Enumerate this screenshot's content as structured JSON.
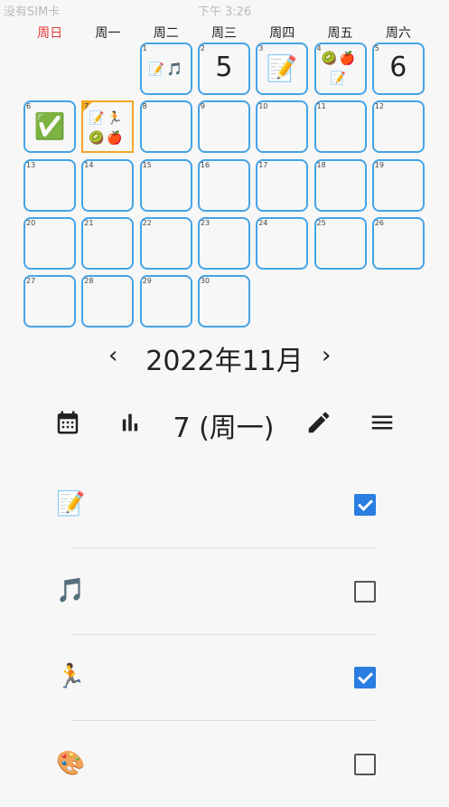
{
  "status": {
    "carrier": "没有SIM卡",
    "time": "下午 3:26"
  },
  "weekdays": [
    "周日",
    "周一",
    "周二",
    "周三",
    "周四",
    "周五",
    "周六"
  ],
  "calendar": {
    "days": [
      {
        "n": "1",
        "col": 2,
        "row": 0,
        "icons": [
          "📝",
          "🎵"
        ]
      },
      {
        "n": "2",
        "col": 3,
        "row": 0,
        "big": "5"
      },
      {
        "n": "3",
        "col": 4,
        "row": 0,
        "bigicon": "📝"
      },
      {
        "n": "4",
        "col": 5,
        "row": 0,
        "icons": [
          "🥝",
          "🍎",
          "📝"
        ]
      },
      {
        "n": "5",
        "col": 6,
        "row": 0,
        "big": "6"
      },
      {
        "n": "6",
        "col": 0,
        "row": 1,
        "bigicon": "✅"
      },
      {
        "n": "7",
        "col": 1,
        "row": 1,
        "selected": true,
        "icons": [
          "📝",
          "🏃",
          "🥝",
          "🍎"
        ]
      },
      {
        "n": "8",
        "col": 2,
        "row": 1
      },
      {
        "n": "9",
        "col": 3,
        "row": 1
      },
      {
        "n": "10",
        "col": 4,
        "row": 1
      },
      {
        "n": "11",
        "col": 5,
        "row": 1
      },
      {
        "n": "12",
        "col": 6,
        "row": 1
      },
      {
        "n": "13",
        "col": 0,
        "row": 2
      },
      {
        "n": "14",
        "col": 1,
        "row": 2
      },
      {
        "n": "15",
        "col": 2,
        "row": 2
      },
      {
        "n": "16",
        "col": 3,
        "row": 2
      },
      {
        "n": "17",
        "col": 4,
        "row": 2
      },
      {
        "n": "18",
        "col": 5,
        "row": 2
      },
      {
        "n": "19",
        "col": 6,
        "row": 2
      },
      {
        "n": "20",
        "col": 0,
        "row": 3
      },
      {
        "n": "21",
        "col": 1,
        "row": 3
      },
      {
        "n": "22",
        "col": 2,
        "row": 3
      },
      {
        "n": "23",
        "col": 3,
        "row": 3
      },
      {
        "n": "24",
        "col": 4,
        "row": 3
      },
      {
        "n": "25",
        "col": 5,
        "row": 3
      },
      {
        "n": "26",
        "col": 6,
        "row": 3
      },
      {
        "n": "27",
        "col": 0,
        "row": 4
      },
      {
        "n": "28",
        "col": 1,
        "row": 4
      },
      {
        "n": "29",
        "col": 2,
        "row": 4
      },
      {
        "n": "30",
        "col": 3,
        "row": 4
      }
    ]
  },
  "month_nav": {
    "title": "2022年11月",
    "prev": "‹",
    "next": "›"
  },
  "toolbar": {
    "day_label": "7 (周一)"
  },
  "tasks": [
    {
      "icon": "📝",
      "checked": true
    },
    {
      "icon": "🎵",
      "checked": false
    },
    {
      "icon": "🏃",
      "checked": true
    },
    {
      "icon": "🎨",
      "checked": false
    }
  ],
  "colors": {
    "accent": "#45a3e6",
    "selected": "#f5a623",
    "check": "#2a7de1",
    "sunday": "#e53935"
  }
}
